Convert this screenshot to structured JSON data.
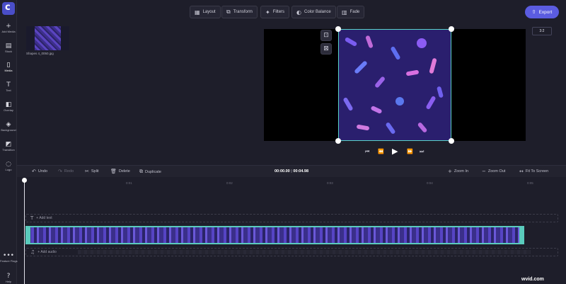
{
  "sidebar": {
    "items": [
      {
        "label": "Add Media",
        "icon": "plus-icon"
      },
      {
        "label": "Stock",
        "icon": "stock-icon"
      },
      {
        "label": "Media",
        "icon": "media-icon"
      },
      {
        "label": "Text",
        "icon": "text-icon"
      },
      {
        "label": "Overlay",
        "icon": "overlay-icon"
      },
      {
        "label": "Background",
        "icon": "layers-icon"
      },
      {
        "label": "Transition",
        "icon": "transition-icon"
      },
      {
        "label": "Logo",
        "icon": "logo-icon"
      }
    ],
    "bottom": [
      {
        "label": "Feature Flags",
        "icon": "more-icon"
      },
      {
        "label": "Help",
        "icon": "help-icon"
      }
    ]
  },
  "toolbar": {
    "layout": "Layout",
    "transform": "Transform",
    "filters": "Filters",
    "color_balance": "Color Balance",
    "fade": "Fade",
    "export": "Export"
  },
  "media": {
    "file_name": "Shapes 4_0050.jpg"
  },
  "preview": {
    "aspect_ratio": "3:2"
  },
  "timeline": {
    "undo": "Undo",
    "redo": "Redo",
    "split": "Split",
    "delete": "Delete",
    "duplicate": "Duplicate",
    "current_time": "00:00.00",
    "separator": " | ",
    "total_time": "00:04.98",
    "zoom_in": "Zoom In",
    "zoom_out": "Zoom Out",
    "fit_to_screen": "Fit To Screen",
    "ruler": [
      "0:01",
      "0:02",
      "0:03",
      "0:04",
      "0:05"
    ],
    "add_text": "+ Add text",
    "add_audio": "+ Add audio"
  },
  "watermark": "wvid.com",
  "colors": {
    "accent": "#5b5ce0",
    "clip_border": "#5acbbd",
    "background": "#1e1e2a"
  }
}
